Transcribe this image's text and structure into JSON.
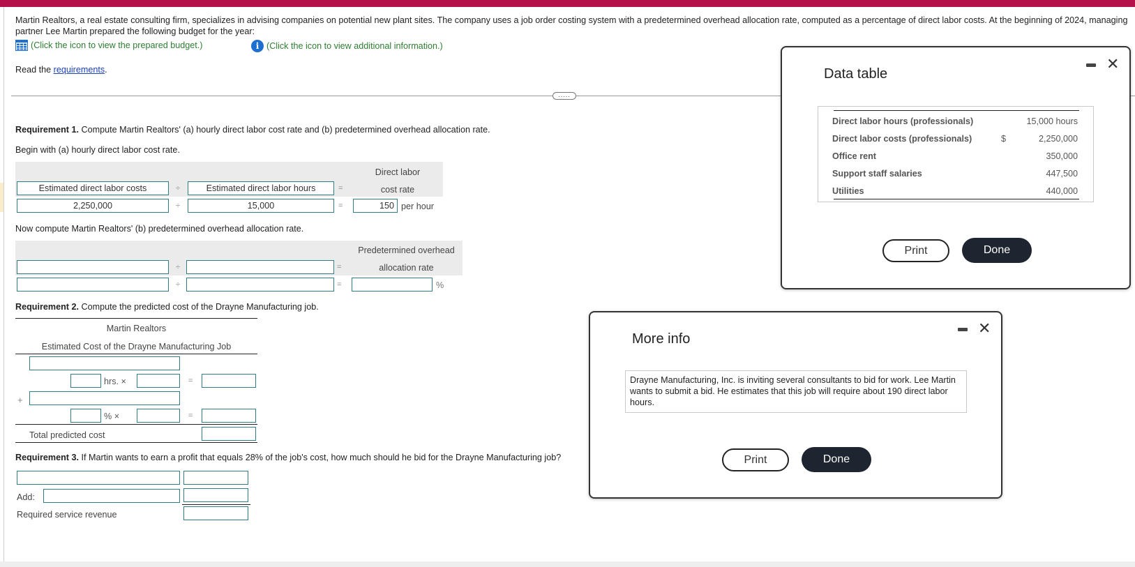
{
  "intro": {
    "text": "Martin Realtors, a real estate consulting firm, specializes in advising companies on potential new plant sites. The company uses a job order costing system with a predetermined overhead allocation rate, computed as a percentage of direct labor costs. At the beginning of 2024, managing partner Lee Martin prepared the following budget for the year:",
    "budget_link": "(Click the icon to view the prepared budget.)",
    "info_link": "(Click the icon to view additional information.)",
    "read_prefix": "Read the ",
    "read_link": "requirements",
    "read_suffix": ".",
    "more_pill": "....."
  },
  "req1": {
    "heading_bold": "Requirement 1.",
    "heading_text": " Compute Martin Realtors' (a) hourly direct labor cost rate and (b) predetermined overhead allocation rate.",
    "part_a_prompt": "Begin with (a) hourly direct labor cost rate.",
    "part_a": {
      "header_left": "Estimated direct labor costs",
      "header_mid": "Estimated direct labor hours",
      "result_label_line1": "Direct labor",
      "result_label_line2": "cost rate",
      "divide": "÷",
      "equals": "=",
      "value_left": "2,250,000",
      "value_mid": "15,000",
      "value_result": "150",
      "result_unit": "per hour"
    },
    "part_b_prompt": "Now compute Martin Realtors' (b) predetermined overhead allocation rate.",
    "part_b": {
      "header_left": "",
      "header_mid": "",
      "result_label_line1": "Predetermined overhead",
      "result_label_line2": "allocation rate",
      "divide": "÷",
      "equals": "=",
      "value_left": "",
      "value_mid": "",
      "value_result": "",
      "result_unit": "%"
    }
  },
  "req2": {
    "heading_bold": "Requirement 2.",
    "heading_text": " Compute the predicted cost of the Drayne Manufacturing job.",
    "company": "Martin Realtors",
    "statement_title": "Estimated Cost of the Drayne Manufacturing Job",
    "row1_label": "",
    "row1_qty": "",
    "row1_unit": "hrs. ×",
    "row1_rate": "",
    "row1_result": "",
    "plus": "+",
    "row2_label": "",
    "row2_qty": "",
    "row2_unit": "% ×",
    "row2_rate": "",
    "row2_result": "",
    "equals": "=",
    "total_label": "Total predicted cost",
    "total_value": ""
  },
  "req3": {
    "heading_bold": "Requirement 3.",
    "heading_text": " If Martin wants to earn a profit that equals 28% of the job's cost, how much should he bid for the Drayne Manufacturing job?",
    "row1_label": "",
    "row1_value": "",
    "add_label": "Add:",
    "row2_label": "",
    "row2_value": "",
    "total_label": "Required service revenue",
    "total_value": ""
  },
  "data_table_dialog": {
    "title": "Data table",
    "rows": [
      {
        "label": "Direct labor hours (professionals)",
        "currency": "",
        "value": "15,000 hours"
      },
      {
        "label": "Direct labor costs (professionals)",
        "currency": "$",
        "value": "2,250,000"
      },
      {
        "label": "Office rent",
        "currency": "",
        "value": "350,000"
      },
      {
        "label": "Support staff salaries",
        "currency": "",
        "value": "447,500"
      },
      {
        "label": "Utilities",
        "currency": "",
        "value": "440,000"
      }
    ],
    "print_label": "Print",
    "done_label": "Done",
    "close_glyph": "✕"
  },
  "more_info_dialog": {
    "title": "More info",
    "body": "Drayne Manufacturing, Inc. is inviting several consultants to bid for work. Lee Martin wants to submit a bid. He estimates that this job will require about 190 direct labor hours.",
    "print_label": "Print",
    "done_label": "Done",
    "close_glyph": "✕"
  },
  "colors": {
    "top_bar": "#b5104a",
    "link_green": "#2e7d32",
    "input_border": "#2f7d85",
    "done_button": "#1e2530"
  }
}
